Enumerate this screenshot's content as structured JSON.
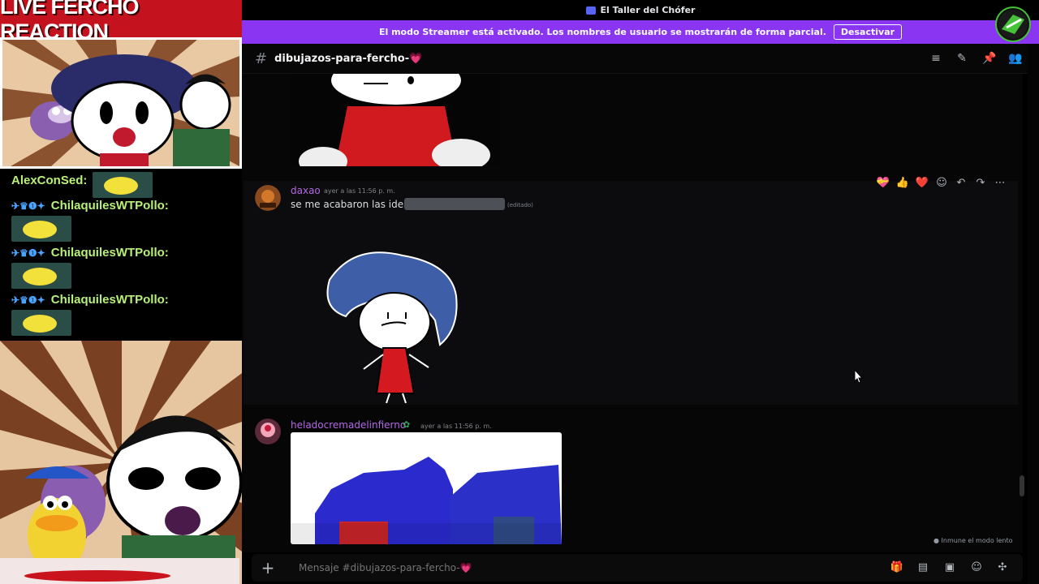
{
  "overlay": {
    "title": "LIVE FERCHO REACTION",
    "chat": [
      {
        "user": "AlexConSed:",
        "badges": ""
      },
      {
        "user": "ChilaquilesWTPollo:",
        "badges": "✈♛❶✦"
      },
      {
        "user": "ChilaquilesWTPollo:",
        "badges": "✈♛❶✦"
      },
      {
        "user": "ChilaquilesWTPollo:",
        "badges": "✈♛❶✦"
      }
    ]
  },
  "discord": {
    "server_name": "El Taller del Chófer",
    "streamer_banner": {
      "text": "El modo Streamer está activado. Los nombres de usuario se mostrarán de forma parcial.",
      "button": "Desactivar"
    },
    "channel": {
      "hash": "#",
      "name": "dibujazos-para-fercho-💗"
    },
    "messages": [
      {
        "user": "daxao",
        "timestamp": "ayer a las 11:56 p. m.",
        "text": "se me acabaron las ideas",
        "edited": "(editado)"
      },
      {
        "user": "heladocremadelinfierno",
        "timestamp": "ayer a las 11:56 p. m.",
        "text": ""
      }
    ],
    "reactions": [
      "💝",
      "👍",
      "❤️"
    ],
    "slow_mode": "Inmune el modo lento",
    "composer_placeholder": "Mensaje #dibujazos-para-fercho-💗"
  },
  "colors": {
    "streamer_bar": "#8a35f2",
    "username": "#b368e6",
    "chat_user": "#b8f07a",
    "title_bar": "#c4121e"
  }
}
